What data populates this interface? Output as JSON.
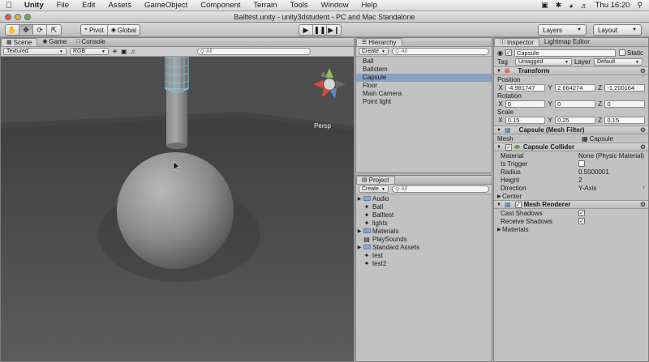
{
  "menubar": {
    "app": "Unity",
    "items": [
      "File",
      "Edit",
      "Assets",
      "GameObject",
      "Component",
      "Terrain",
      "Tools",
      "Window",
      "Help"
    ],
    "clock": "Thu 16:20"
  },
  "window": {
    "title": "Balltest.unity - unity3dstudent - PC and Mac Standalone"
  },
  "toolbar": {
    "pivot": "Pivot",
    "global": "Global",
    "layers": "Layers",
    "layout": "Layout"
  },
  "scene": {
    "tabs": [
      "Scene",
      "Game",
      "Console"
    ],
    "render_mode": "Textured",
    "color_mode": "RGB",
    "search_placeholder": "All",
    "persp_label": "Persp"
  },
  "hierarchy": {
    "tab": "Hierarchy",
    "create": "Create",
    "search_placeholder": "All",
    "items": [
      "Ball",
      "Ballstem",
      "Capsule",
      "Floor",
      "Main Camera",
      "Point light"
    ],
    "selected_index": 2
  },
  "project": {
    "tab": "Project",
    "create": "Create",
    "search_placeholder": "All",
    "items": [
      {
        "label": "Audio",
        "kind": "folder",
        "expandable": true
      },
      {
        "label": "Ball",
        "kind": "prefab",
        "expandable": false
      },
      {
        "label": "Balltest",
        "kind": "scene",
        "expandable": false
      },
      {
        "label": "lights",
        "kind": "prefab",
        "expandable": false
      },
      {
        "label": "Materials",
        "kind": "folder",
        "expandable": true
      },
      {
        "label": "PlaySounds",
        "kind": "script",
        "expandable": false
      },
      {
        "label": "Standard Assets",
        "kind": "folder",
        "expandable": true
      },
      {
        "label": "test",
        "kind": "prefab",
        "expandable": false
      },
      {
        "label": "test2",
        "kind": "prefab",
        "expandable": false
      }
    ]
  },
  "inspector": {
    "tabs": [
      "Inspector",
      "Lightmap Editor"
    ],
    "object_name": "Capsule",
    "static_label": "Static",
    "tag_label": "Tag",
    "tag_value": "Untagged",
    "layer_label": "Layer",
    "layer_value": "Default",
    "transform": {
      "title": "Transform",
      "position_label": "Position",
      "position": {
        "x": "-4.981747",
        "y": "2.664274",
        "z": "-1.200164"
      },
      "rotation_label": "Rotation",
      "rotation": {
        "x": "0",
        "y": "0",
        "z": "0"
      },
      "scale_label": "Scale",
      "scale": {
        "x": "0.15",
        "y": "0.25",
        "z": "0.15"
      }
    },
    "mesh_filter": {
      "title": "Capsule (Mesh Filter)",
      "mesh_label": "Mesh",
      "mesh_value": "Capsule"
    },
    "capsule_collider": {
      "title": "Capsule Collider",
      "material_label": "Material",
      "material_value": "None (Physic Material)",
      "trigger_label": "Is Trigger",
      "radius_label": "Radius",
      "radius_value": "0.5000001",
      "height_label": "Height",
      "height_value": "2",
      "direction_label": "Direction",
      "direction_value": "Y-Axis",
      "center_label": "Center"
    },
    "mesh_renderer": {
      "title": "Mesh Renderer",
      "cast_label": "Cast Shadows",
      "receive_label": "Receive Shadows",
      "materials_label": "Materials"
    }
  },
  "colors": {
    "selection": "#8aa0c4",
    "panel": "#c2c2c2",
    "scene_bg": "#4c4c4c"
  }
}
